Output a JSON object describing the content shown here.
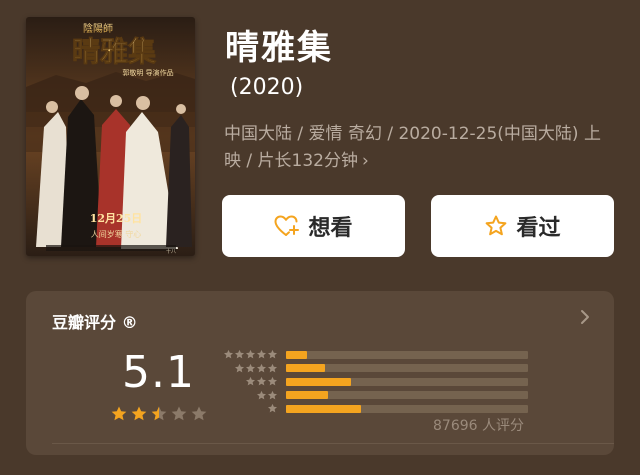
{
  "movie": {
    "title": "晴雅集",
    "year": "(2020)",
    "meta": "中国大陆 / 爱情 奇幻 / 2020-12-25(中国大陆) 上映 / 片长132分钟",
    "chevron": "›"
  },
  "poster": {
    "series": "陰陽師",
    "title": "晴雅集",
    "credit": "郭敬明 导演作品",
    "date": "12月25日",
    "tagline": "人间岁寒 守心",
    "bottom_mark": "十八"
  },
  "actions": {
    "want_label": "想看",
    "seen_label": "看过"
  },
  "rating": {
    "label": "豆瓣评分 ®",
    "score": "5.1",
    "stars_filled": 2.5,
    "stars_total": 5,
    "count_text": "87696 人评分",
    "distribution": [
      {
        "stars": 5,
        "fraction": 0.085
      },
      {
        "stars": 4,
        "fraction": 0.16
      },
      {
        "stars": 3,
        "fraction": 0.27
      },
      {
        "stars": 2,
        "fraction": 0.175
      },
      {
        "stars": 1,
        "fraction": 0.31
      }
    ]
  },
  "colors": {
    "background": "#4a392b",
    "card": "#5a4839",
    "accent": "#f4a41f",
    "track": "#75634f",
    "muted_text": "#b9aca0"
  }
}
